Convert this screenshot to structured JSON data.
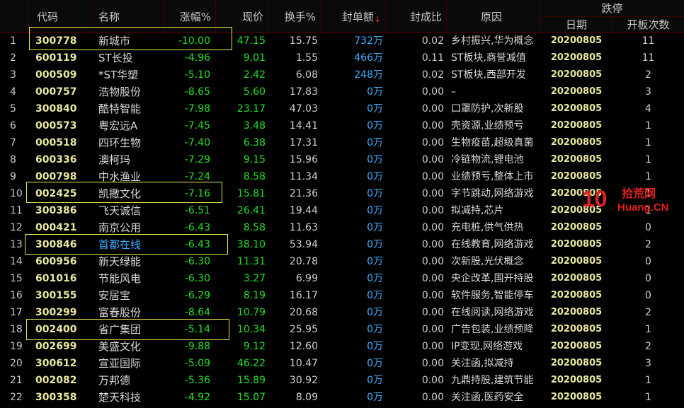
{
  "header": {
    "code": "代码",
    "name": "名称",
    "change": "涨幅%",
    "price": "现价",
    "turnover": "换手%",
    "seal_amount": "封单额",
    "seal_ratio": "封成比",
    "reason": "原因",
    "group_title": "跌停",
    "date": "日期",
    "open_count": "开板次数"
  },
  "unit_wan": "万",
  "watermark": {
    "number": "10",
    "text_top": "拾荒网",
    "text_bottom": "Huang.CN"
  },
  "rows": [
    {
      "idx": "1",
      "code": "300778",
      "name": "新城市",
      "change": "-10.00",
      "price": "47.15",
      "turnover": "15.75",
      "seal": "732",
      "ratio": "0.02",
      "reason": "乡村振兴,华为概念",
      "date": "20200805",
      "count": "11"
    },
    {
      "idx": "2",
      "code": "600119",
      "name": "ST长投",
      "change": "-4.96",
      "price": "9.01",
      "turnover": "1.55",
      "seal": "466",
      "ratio": "0.11",
      "reason": "ST板块,商誉减值",
      "date": "20200805",
      "count": "11"
    },
    {
      "idx": "3",
      "code": "000509",
      "name": "*ST华塑",
      "change": "-5.10",
      "price": "2.42",
      "turnover": "6.08",
      "seal": "248",
      "ratio": "0.02",
      "reason": "ST板块,西部开发",
      "date": "20200805",
      "count": "2"
    },
    {
      "idx": "4",
      "code": "000757",
      "name": "浩物股份",
      "change": "-8.65",
      "price": "5.60",
      "turnover": "17.83",
      "seal": "0",
      "ratio": "0.00",
      "reason": "–",
      "date": "20200805",
      "count": "3"
    },
    {
      "idx": "5",
      "code": "300840",
      "name": "酷特智能",
      "change": "-7.98",
      "price": "23.17",
      "turnover": "47.03",
      "seal": "0",
      "ratio": "0.00",
      "reason": "口罩防护,次新股",
      "date": "20200805",
      "count": "4"
    },
    {
      "idx": "6",
      "code": "000573",
      "name": "粤宏远A",
      "change": "-7.45",
      "price": "3.48",
      "turnover": "14.41",
      "seal": "0",
      "ratio": "0.00",
      "reason": "壳资源,业绩预亏",
      "date": "20200805",
      "count": "1"
    },
    {
      "idx": "7",
      "code": "000518",
      "name": "四环生物",
      "change": "-7.40",
      "price": "6.38",
      "turnover": "17.31",
      "seal": "0",
      "ratio": "0.00",
      "reason": "生物疫苗,超级真菌",
      "date": "20200805",
      "count": "1"
    },
    {
      "idx": "8",
      "code": "600336",
      "name": "澳柯玛",
      "change": "-7.29",
      "price": "9.15",
      "turnover": "15.96",
      "seal": "0",
      "ratio": "0.00",
      "reason": "冷链物流,锂电池",
      "date": "20200805",
      "count": "1"
    },
    {
      "idx": "9",
      "code": "000798",
      "name": "中水渔业",
      "change": "-7.24",
      "price": "8.58",
      "turnover": "11.34",
      "seal": "0",
      "ratio": "0.00",
      "reason": "业绩预亏,整体上市",
      "date": "20200805",
      "count": "1"
    },
    {
      "idx": "10",
      "code": "002425",
      "name": "凯撒文化",
      "change": "-7.16",
      "price": "15.81",
      "turnover": "21.36",
      "seal": "0",
      "ratio": "0.00",
      "reason": "字节跳动,网络游戏",
      "date": "20200805",
      "count": "1"
    },
    {
      "idx": "11",
      "code": "300386",
      "name": "飞天诚信",
      "change": "-6.51",
      "price": "26.41",
      "turnover": "19.44",
      "seal": "0",
      "ratio": "0.00",
      "reason": "拟减持,芯片",
      "date": "20200805",
      "count": "1"
    },
    {
      "idx": "12",
      "code": "000421",
      "name": "南京公用",
      "change": "-6.43",
      "price": "8.58",
      "turnover": "11.63",
      "seal": "0",
      "ratio": "0.00",
      "reason": "充电桩,供气供热",
      "date": "20200805",
      "count": "0"
    },
    {
      "idx": "13",
      "code": "300846",
      "name": "首都在线",
      "change": "-6.43",
      "price": "38.10",
      "turnover": "53.94",
      "seal": "0",
      "ratio": "0.00",
      "reason": "在线教育,网络游戏",
      "date": "20200805",
      "count": "2",
      "blue": true
    },
    {
      "idx": "14",
      "code": "600956",
      "name": "新天绿能",
      "change": "-6.30",
      "price": "11.31",
      "turnover": "20.78",
      "seal": "0",
      "ratio": "0.00",
      "reason": "次新股,光伏概念",
      "date": "20200805",
      "count": "0"
    },
    {
      "idx": "15",
      "code": "601016",
      "name": "节能风电",
      "change": "-6.30",
      "price": "3.27",
      "turnover": "6.99",
      "seal": "0",
      "ratio": "0.00",
      "reason": "央企改革,国开持股",
      "date": "20200805",
      "count": "0"
    },
    {
      "idx": "16",
      "code": "300155",
      "name": "安居宝",
      "change": "-6.29",
      "price": "8.19",
      "turnover": "16.17",
      "seal": "0",
      "ratio": "0.00",
      "reason": "软件服务,智能停车",
      "date": "20200805",
      "count": "0"
    },
    {
      "idx": "17",
      "code": "300299",
      "name": "富春股份",
      "change": "-8.64",
      "price": "10.79",
      "turnover": "20.68",
      "seal": "0",
      "ratio": "0.00",
      "reason": "在线阅读,网络游戏",
      "date": "20200805",
      "count": "2"
    },
    {
      "idx": "18",
      "code": "002400",
      "name": "省广集团",
      "change": "-5.14",
      "price": "10.34",
      "turnover": "25.95",
      "seal": "0",
      "ratio": "0.00",
      "reason": "广告包装,业绩预降",
      "date": "20200805",
      "count": "1"
    },
    {
      "idx": "19",
      "code": "002699",
      "name": "美盛文化",
      "change": "-9.88",
      "price": "9.12",
      "turnover": "12.60",
      "seal": "0",
      "ratio": "0.00",
      "reason": "IP变现,网络游戏",
      "date": "20200805",
      "count": "2"
    },
    {
      "idx": "20",
      "code": "300612",
      "name": "宣亚国际",
      "change": "-5.09",
      "price": "46.22",
      "turnover": "10.47",
      "seal": "0",
      "ratio": "0.00",
      "reason": "关注函,拟减持",
      "date": "20200805",
      "count": "3"
    },
    {
      "idx": "21",
      "code": "002082",
      "name": "万邦德",
      "change": "-5.36",
      "price": "15.89",
      "turnover": "30.92",
      "seal": "0",
      "ratio": "0.00",
      "reason": "九鼎持股,建筑节能",
      "date": "20200805",
      "count": "1"
    },
    {
      "idx": "22",
      "code": "300358",
      "name": "楚天科技",
      "change": "-4.92",
      "price": "15.07",
      "turnover": "8.09",
      "seal": "0",
      "ratio": "0.00",
      "reason": "关注函,医药安全",
      "date": "20200805",
      "count": "1"
    }
  ]
}
